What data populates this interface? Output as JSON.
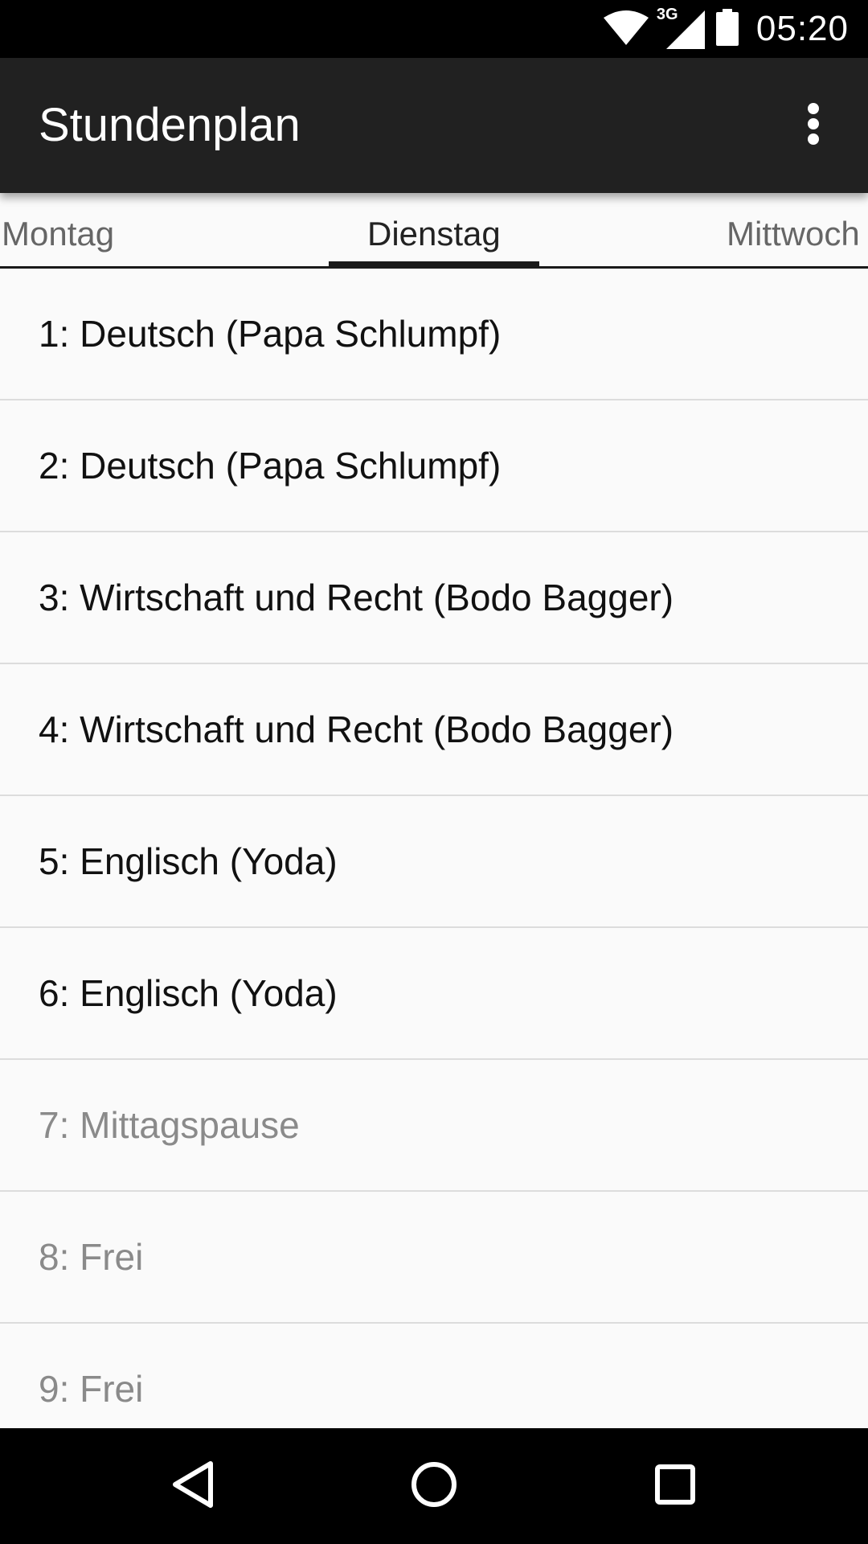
{
  "status_bar": {
    "network": "3G",
    "time": "05:20",
    "icons": [
      "wifi-icon",
      "cell-signal-icon",
      "battery-icon"
    ]
  },
  "app_bar": {
    "title": "Stundenplan",
    "menu_icon": "more-vert-icon"
  },
  "tabs": [
    {
      "label": "Montag",
      "active": false
    },
    {
      "label": "Dienstag",
      "active": true
    },
    {
      "label": "Mittwoch",
      "active": false
    }
  ],
  "lessons": [
    {
      "label": "1: Deutsch (Papa Schlumpf)",
      "dimmed": false
    },
    {
      "label": "2: Deutsch (Papa Schlumpf)",
      "dimmed": false
    },
    {
      "label": "3: Wirtschaft und Recht (Bodo Bagger)",
      "dimmed": false
    },
    {
      "label": "4: Wirtschaft und Recht (Bodo Bagger)",
      "dimmed": false
    },
    {
      "label": "5: Englisch (Yoda)",
      "dimmed": false
    },
    {
      "label": "6: Englisch (Yoda)",
      "dimmed": false
    },
    {
      "label": "7: Mittagspause",
      "dimmed": true
    },
    {
      "label": "8: Frei",
      "dimmed": true
    },
    {
      "label": "9: Frei",
      "dimmed": true
    }
  ],
  "nav_bar": {
    "icons": [
      "back-icon",
      "home-icon",
      "recents-icon"
    ]
  },
  "colors": {
    "app_bar": "#212121",
    "list_background": "#fafafa",
    "text_primary": "#111111",
    "text_dimmed": "#8a8a8a",
    "divider": "#dcdcdc"
  }
}
